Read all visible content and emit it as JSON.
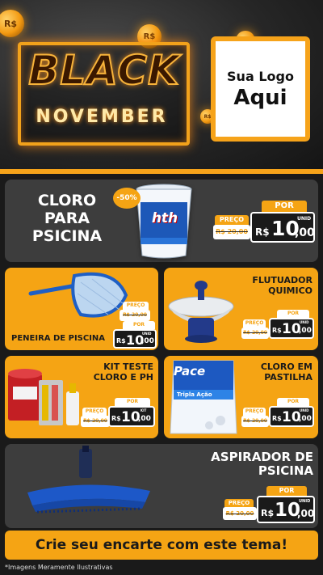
{
  "header": {
    "black": "BLACK",
    "november": "NOVEMBER",
    "coin_symbol": "R$",
    "logo_line1": "Sua Logo",
    "logo_line2": "Aqui"
  },
  "products": [
    {
      "title_lines": [
        "CLORO",
        "PARA",
        "PSICINA"
      ],
      "discount_badge": "-50%",
      "brand": "hth",
      "preco_label": "PREÇO",
      "old_price": "R$ 20,00",
      "por_label": "POR",
      "unit": "UNID",
      "currency": "R$",
      "price_int": "10",
      "price_dec": ",00"
    },
    {
      "title": "PENEIRA DE PISCINA",
      "preco_label": "PREÇO",
      "old_price": "R$ 20,00",
      "por_label": "POR",
      "unit": "UNID",
      "currency": "R$",
      "price_int": "10",
      "price_dec": ",00"
    },
    {
      "title_lines": [
        "FLUTUADOR",
        "QUIMICO"
      ],
      "preco_label": "PREÇO",
      "old_price": "R$ 20,00",
      "por_label": "POR",
      "unit": "UNID",
      "currency": "R$",
      "price_int": "10",
      "price_dec": ",00"
    },
    {
      "title_lines": [
        "KIT TESTE",
        "CLORO E PH"
      ],
      "preco_label": "PREÇO",
      "old_price": "R$ 20,00",
      "por_label": "POR",
      "unit": "KIT",
      "currency": "R$",
      "price_int": "10",
      "price_dec": ",00"
    },
    {
      "title_lines": [
        "CLORO EM",
        "PASTILHA"
      ],
      "brand": "Pace",
      "brand_sub": "Tripla Ação",
      "preco_label": "PREÇO",
      "old_price": "R$ 20,00",
      "por_label": "POR",
      "unit": "UNID",
      "currency": "R$",
      "price_int": "10",
      "price_dec": ",00"
    },
    {
      "title_lines": [
        "ASPIRADOR DE",
        "PSICINA"
      ],
      "preco_label": "PREÇO",
      "old_price": "R$ 20,00",
      "por_label": "POR",
      "unit": "UNID",
      "currency": "R$",
      "price_int": "10",
      "price_dec": ",00"
    }
  ],
  "footer": {
    "banner": "Crie seu encarte com este tema!",
    "disclaimer": "*Imagens Meramente Ilustrativas"
  },
  "colors": {
    "accent": "#f5a414",
    "dark_card": "#3d3d3d",
    "background": "#1a1a1a"
  }
}
